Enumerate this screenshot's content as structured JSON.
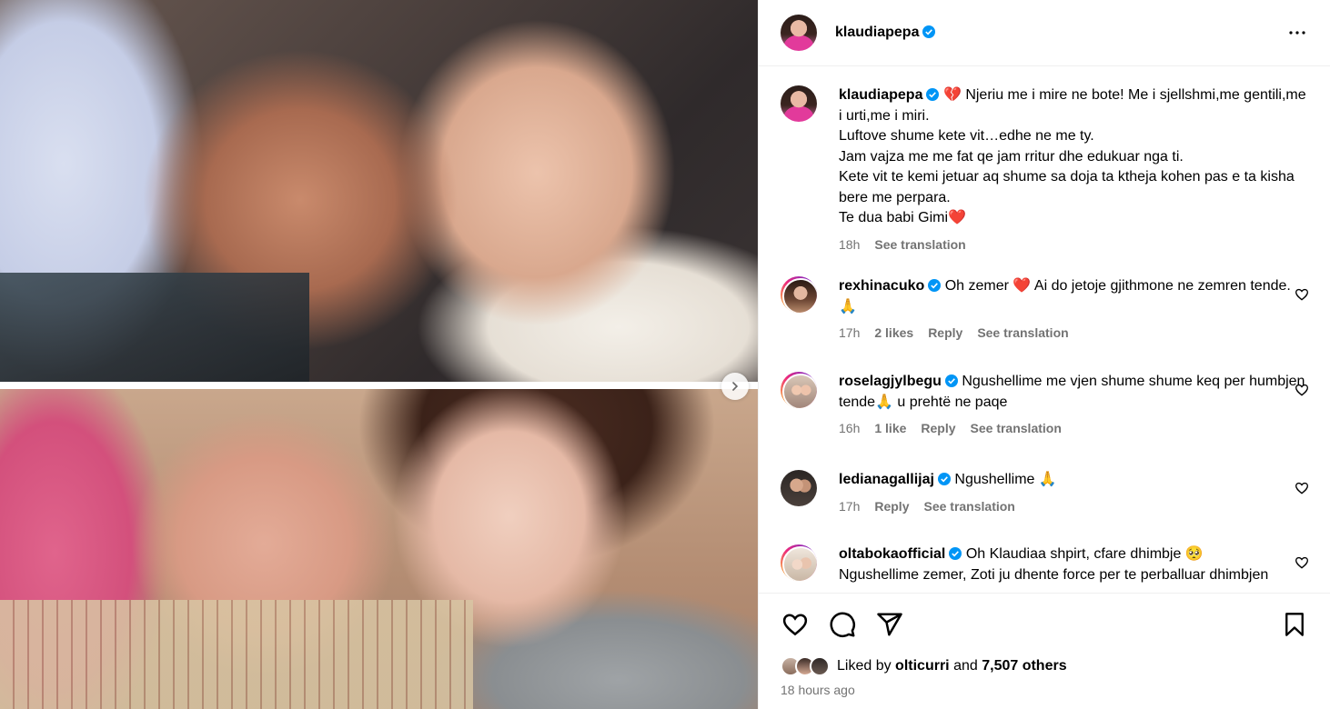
{
  "post": {
    "author": "klaudiapepa",
    "caption_lines": "Njeriu me i mire ne bote! Me i sjellshmi,me gentili,me i urti,me i miri.\nLuftove shume kete vit…edhe ne me ty.\nJam vajza me me fat qe jam rritur dhe edukuar nga ti.\nKete vit te kemi jetuar aq shume sa doja ta ktheja kohen pas e ta kisha bere me perpara.\nTe dua babi Gimi",
    "caption_emoji": "💔",
    "caption_end_emoji": "❤️",
    "caption_time": "18h",
    "see_translation": "See translation"
  },
  "comments": [
    {
      "user": "rexhinacuko",
      "text": "Oh zemer ❤️  Ai do jetoje gjithmone ne zemren tende. 🙏",
      "time": "17h",
      "likes": "2 likes",
      "reply": "Reply",
      "translate": "See translation"
    },
    {
      "user": "roselagjylbegu",
      "text": "Ngushellime me vjen shume shume keq per humbjen tende🙏 u prehtë ne paqe",
      "time": "16h",
      "likes": "1 like",
      "reply": "Reply",
      "translate": "See translation"
    },
    {
      "user": "ledianagallijaj",
      "text": "Ngushellime 🙏",
      "time": "17h",
      "reply": "Reply",
      "translate": "See translation"
    },
    {
      "user": "oltabokaofficial",
      "text": "Oh Klaudiaa shpirt, cfare dhimbje 🥺\nNgushellime zemer, Zoti ju dhente force per te perballuar dhimbjen"
    }
  ],
  "likes_bar": {
    "prefix": "Liked by",
    "user": "olticurri",
    "and": "and",
    "others": "7,507 others",
    "time_ago": "18 hours ago"
  },
  "icons": {
    "verified": "verified-badge-icon",
    "more": "more-options-icon",
    "like": "heart-icon",
    "comment": "comment-icon",
    "share": "share-icon",
    "save": "bookmark-icon",
    "next": "chevron-right-icon"
  },
  "colors": {
    "verified": "#0095f6",
    "muted": "#737373",
    "heart_red": "#ff3040"
  }
}
